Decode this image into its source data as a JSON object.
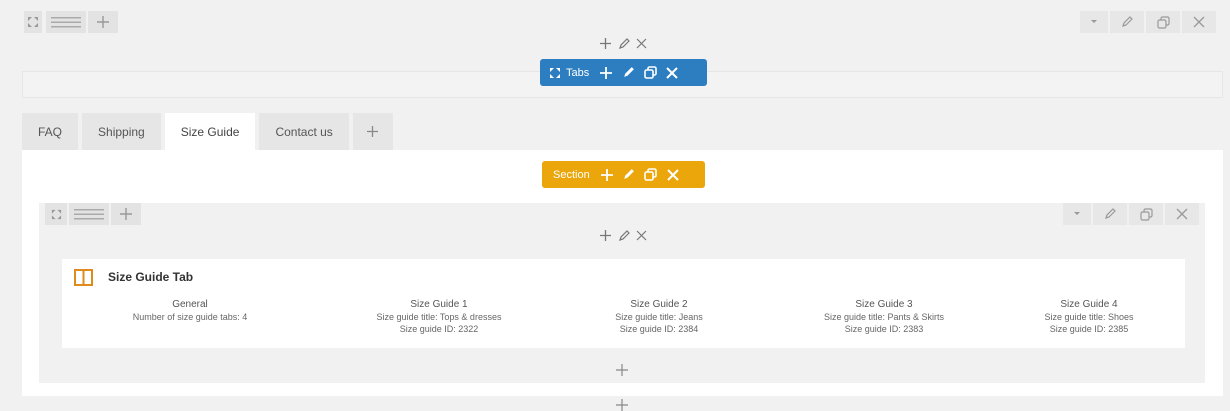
{
  "colors": {
    "tabs_bar": "#2d7ec0",
    "section_bar": "#eaa60b",
    "module_icon": "#e08a1b"
  },
  "tabs_element": {
    "label": "Tabs"
  },
  "section_element": {
    "label": "Section"
  },
  "tabs": [
    {
      "label": "FAQ"
    },
    {
      "label": "Shipping"
    },
    {
      "label": "Size Guide"
    },
    {
      "label": "Contact us"
    }
  ],
  "module": {
    "title": "Size Guide Tab",
    "columns": [
      {
        "heading": "General",
        "lines": [
          "Number of size guide tabs: 4",
          ""
        ]
      },
      {
        "heading": "Size Guide 1",
        "lines": [
          "Size guide title: Tops & dresses",
          "Size guide ID: 2322"
        ]
      },
      {
        "heading": "Size Guide 2",
        "lines": [
          "Size guide title: Jeans",
          "Size guide ID: 2384"
        ]
      },
      {
        "heading": "Size Guide 3",
        "lines": [
          "Size guide title: Pants & Skirts",
          "Size guide ID: 2383"
        ]
      },
      {
        "heading": "Size Guide 4",
        "lines": [
          "Size guide title: Shoes",
          "Size guide ID: 2385"
        ]
      }
    ]
  },
  "icons": [
    "expand-icon",
    "drag-handle-icon",
    "add-icon",
    "chevron-down-icon",
    "pencil-icon",
    "duplicate-icon",
    "close-icon",
    "columns-icon"
  ]
}
